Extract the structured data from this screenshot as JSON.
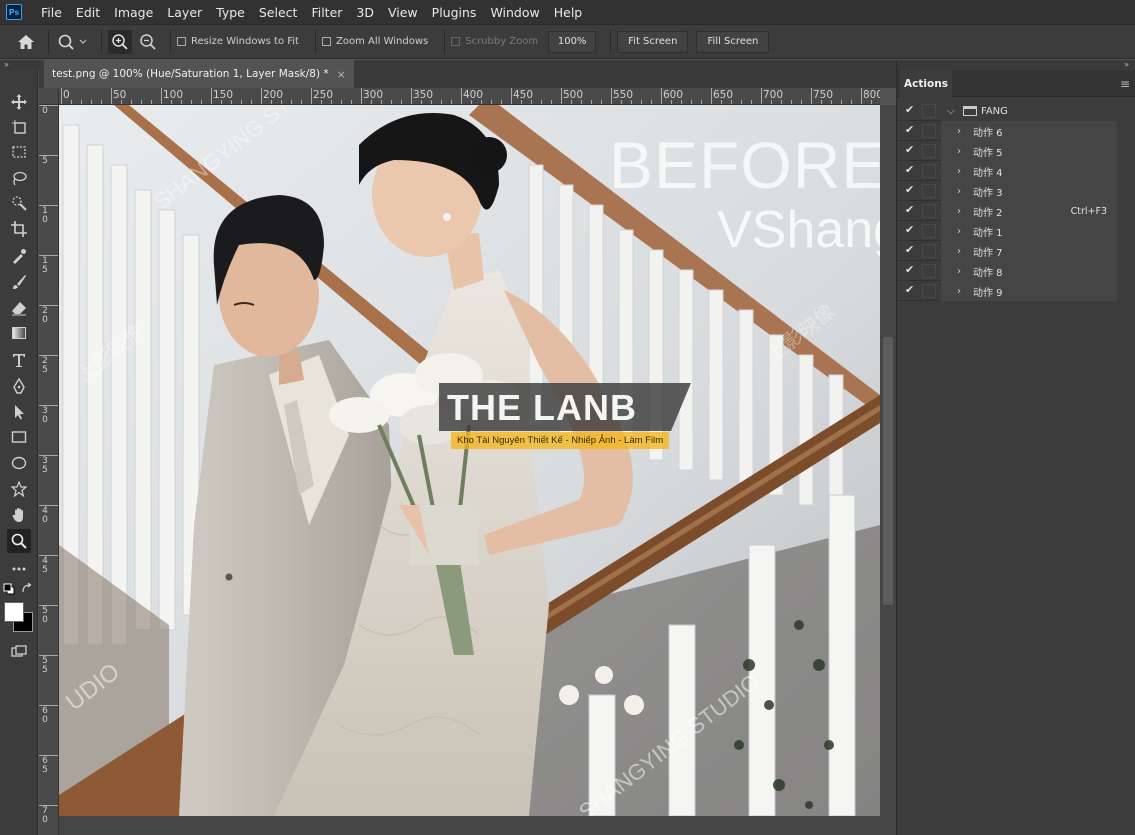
{
  "menu": [
    "File",
    "Edit",
    "Image",
    "Layer",
    "Type",
    "Select",
    "Filter",
    "3D",
    "View",
    "Plugins",
    "Window",
    "Help"
  ],
  "app_logo": "Ps",
  "options": {
    "resize_windows": "Resize Windows to Fit",
    "zoom_all": "Zoom All Windows",
    "scrubby_zoom": "Scrubby Zoom",
    "zoom_value": "100%",
    "fit_screen": "Fit Screen",
    "fill_screen": "Fill Screen"
  },
  "document": {
    "tab_title": "test.png @ 100% (Hue/Saturation 1, Layer Mask/8) *",
    "close": "×"
  },
  "ruler_top": [
    "0",
    "50",
    "100",
    "150",
    "200",
    "250",
    "300",
    "350",
    "400",
    "450",
    "500",
    "550",
    "600",
    "650",
    "700",
    "750",
    "800"
  ],
  "ruler_left": [
    "0",
    "5",
    "1 0",
    "1 5",
    "2 0",
    "2 5",
    "3 0",
    "3 5",
    "4 0",
    "4 5",
    "5 0",
    "5 5",
    "6 0",
    "6 5",
    "7 0"
  ],
  "canvas_overlay": {
    "before": "BEFORE",
    "vshang": "VShang",
    "watermark_en_1": "SHANGYING STUDIO",
    "watermark_en_2": "SHANGYING STUDIO",
    "watermark_cn_1": "上影映像",
    "watermark_cn_2": "上影映像",
    "watermark_udio": "UDIO",
    "brand_title": "THE LANB",
    "brand_subtitle": "Kho Tài Nguyên Thiết Kế - Nhiếp Ảnh - Làm Film"
  },
  "panel": {
    "tab": "Actions",
    "menu_icon": "≡",
    "collapse": "»"
  },
  "actions": [
    {
      "label": "FANG",
      "type": "set",
      "shortcut": ""
    },
    {
      "label": "动作 6",
      "type": "action",
      "shortcut": ""
    },
    {
      "label": "动作 5",
      "type": "action",
      "shortcut": ""
    },
    {
      "label": "动作 4",
      "type": "action",
      "shortcut": ""
    },
    {
      "label": "动作 3",
      "type": "action",
      "shortcut": ""
    },
    {
      "label": "动作 2",
      "type": "action",
      "shortcut": "Ctrl+F3"
    },
    {
      "label": "动作 1",
      "type": "action",
      "shortcut": ""
    },
    {
      "label": "动作 7",
      "type": "action",
      "shortcut": ""
    },
    {
      "label": "动作 8",
      "type": "action",
      "shortcut": ""
    },
    {
      "label": "动作 9",
      "type": "action",
      "shortcut": ""
    }
  ],
  "tools": [
    "move-tool",
    "artboard-tool",
    "marquee-tool",
    "lasso-tool",
    "quick-selection-tool",
    "crop-tool",
    "eyedropper-tool",
    "brush-tool",
    "eraser-tool",
    "gradient-tool",
    "type-tool",
    "pen-tool",
    "path-selection-tool",
    "rectangle-tool",
    "ellipse-tool",
    "custom-shape-tool",
    "hand-tool",
    "zoom-tool",
    "more-tools"
  ],
  "colors": {
    "app_bg": "#535353",
    "panel_bg": "#3c3c3c",
    "menubar_bg": "#323232",
    "brand_yellow": "#f3b71b"
  }
}
